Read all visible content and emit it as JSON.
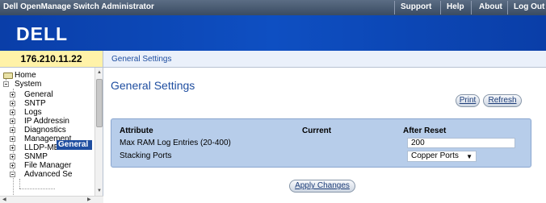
{
  "window": {
    "title": "Dell OpenManage Switch Administrator"
  },
  "top_links": [
    "Support",
    "Help",
    "About",
    "Log Out"
  ],
  "brand": {
    "logo_text": "DELL",
    "banner_color": "#0e4fc2"
  },
  "ip_address": "176.210.11.22",
  "breadcrumb": "General Settings",
  "tree": {
    "home": "Home",
    "system": "System",
    "children": [
      "General",
      "SNTP",
      "Logs",
      "IP Addressin",
      "Diagnostics",
      "Management",
      "LLDP-MED",
      "SNMP",
      "File Manager",
      "Advanced Se"
    ],
    "selected": "General"
  },
  "page": {
    "title": "General Settings"
  },
  "buttons": {
    "print": "Print",
    "refresh": "Refresh",
    "apply": "Apply Changes"
  },
  "table": {
    "headers": {
      "attribute": "Attribute",
      "current": "Current",
      "after_reset": "After Reset"
    },
    "rows": [
      {
        "label": "Max RAM Log Entries (20-400)",
        "current": "",
        "after_reset": "200"
      },
      {
        "label": "Stacking Ports",
        "current": "",
        "after_reset": "Copper Ports"
      }
    ]
  },
  "colors": {
    "accent": "#1f4ea0",
    "panel": "#b7cdea",
    "ip_highlight": "#fff2a8"
  }
}
